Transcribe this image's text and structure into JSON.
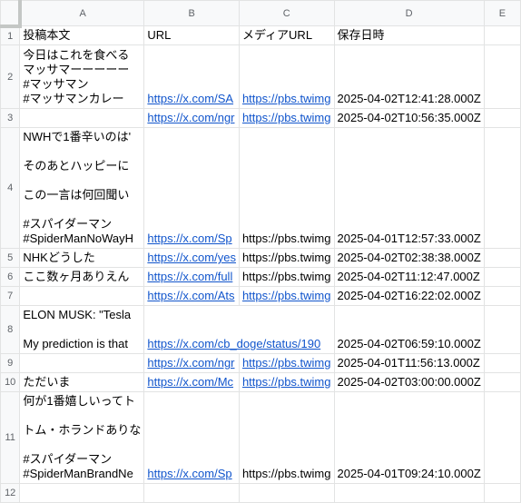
{
  "columns": [
    "A",
    "B",
    "C",
    "D",
    "E"
  ],
  "header_row": {
    "num": "1",
    "a": "投稿本文",
    "b": "URL",
    "c": "メディアURL",
    "d": "保存日時"
  },
  "rows": [
    {
      "num": "2",
      "a": "今日はこれを食べる\nマッサマーーーーー\n#マッサマン\n#マッサマンカレー",
      "b": "https://x.com/SA",
      "c": "https://pbs.twimg",
      "d": "2025-04-02T12:41:28.000Z"
    },
    {
      "num": "3",
      "a": "",
      "b": "https://x.com/ngr",
      "c": "https://pbs.twimg",
      "d": "2025-04-02T10:56:35.000Z"
    },
    {
      "num": "4",
      "a": "NWHで1番辛いのは'\n\nそのあとハッピーに\n\nこの一言は何回聞い\n\n#スパイダーマン\n#SpiderManNoWayH",
      "b": "https://x.com/Sp",
      "c": "https://pbs.twimg",
      "d": "2025-04-01T12:57:33.000Z"
    },
    {
      "num": "5",
      "a": "NHKどうした",
      "b": "https://x.com/yes",
      "c": "https://pbs.twimg",
      "d": "2025-04-02T02:38:38.000Z"
    },
    {
      "num": "6",
      "a": "ここ数ヶ月ありえん",
      "b": "https://x.com/full",
      "c": "https://pbs.twimg",
      "d": "2025-04-02T11:12:47.000Z"
    },
    {
      "num": "7",
      "a": "",
      "b": "https://x.com/Ats",
      "c": "https://pbs.twimg",
      "d": "2025-04-02T16:22:02.000Z"
    },
    {
      "num": "8",
      "a": "ELON MUSK: \"Tesla\n\nMy prediction is that",
      "b": "https://x.com/cb_doge/status/190",
      "c": "",
      "d": "2025-04-02T06:59:10.000Z"
    },
    {
      "num": "9",
      "a": "",
      "b": "https://x.com/ngr",
      "c": "https://pbs.twimg",
      "d": "2025-04-01T11:56:13.000Z"
    },
    {
      "num": "10",
      "a": "ただいま",
      "b": "https://x.com/Mc",
      "c": "https://pbs.twimg",
      "d": "2025-04-02T03:00:00.000Z"
    },
    {
      "num": "11",
      "a": "何が1番嬉しいってト\n\nトム・ホランドありな\n\n#スパイダーマン\n#SpiderManBrandNe",
      "b": "https://x.com/Sp",
      "c": "https://pbs.twimg",
      "d": "2025-04-01T09:24:10.000Z"
    }
  ],
  "last_row_num": "12"
}
